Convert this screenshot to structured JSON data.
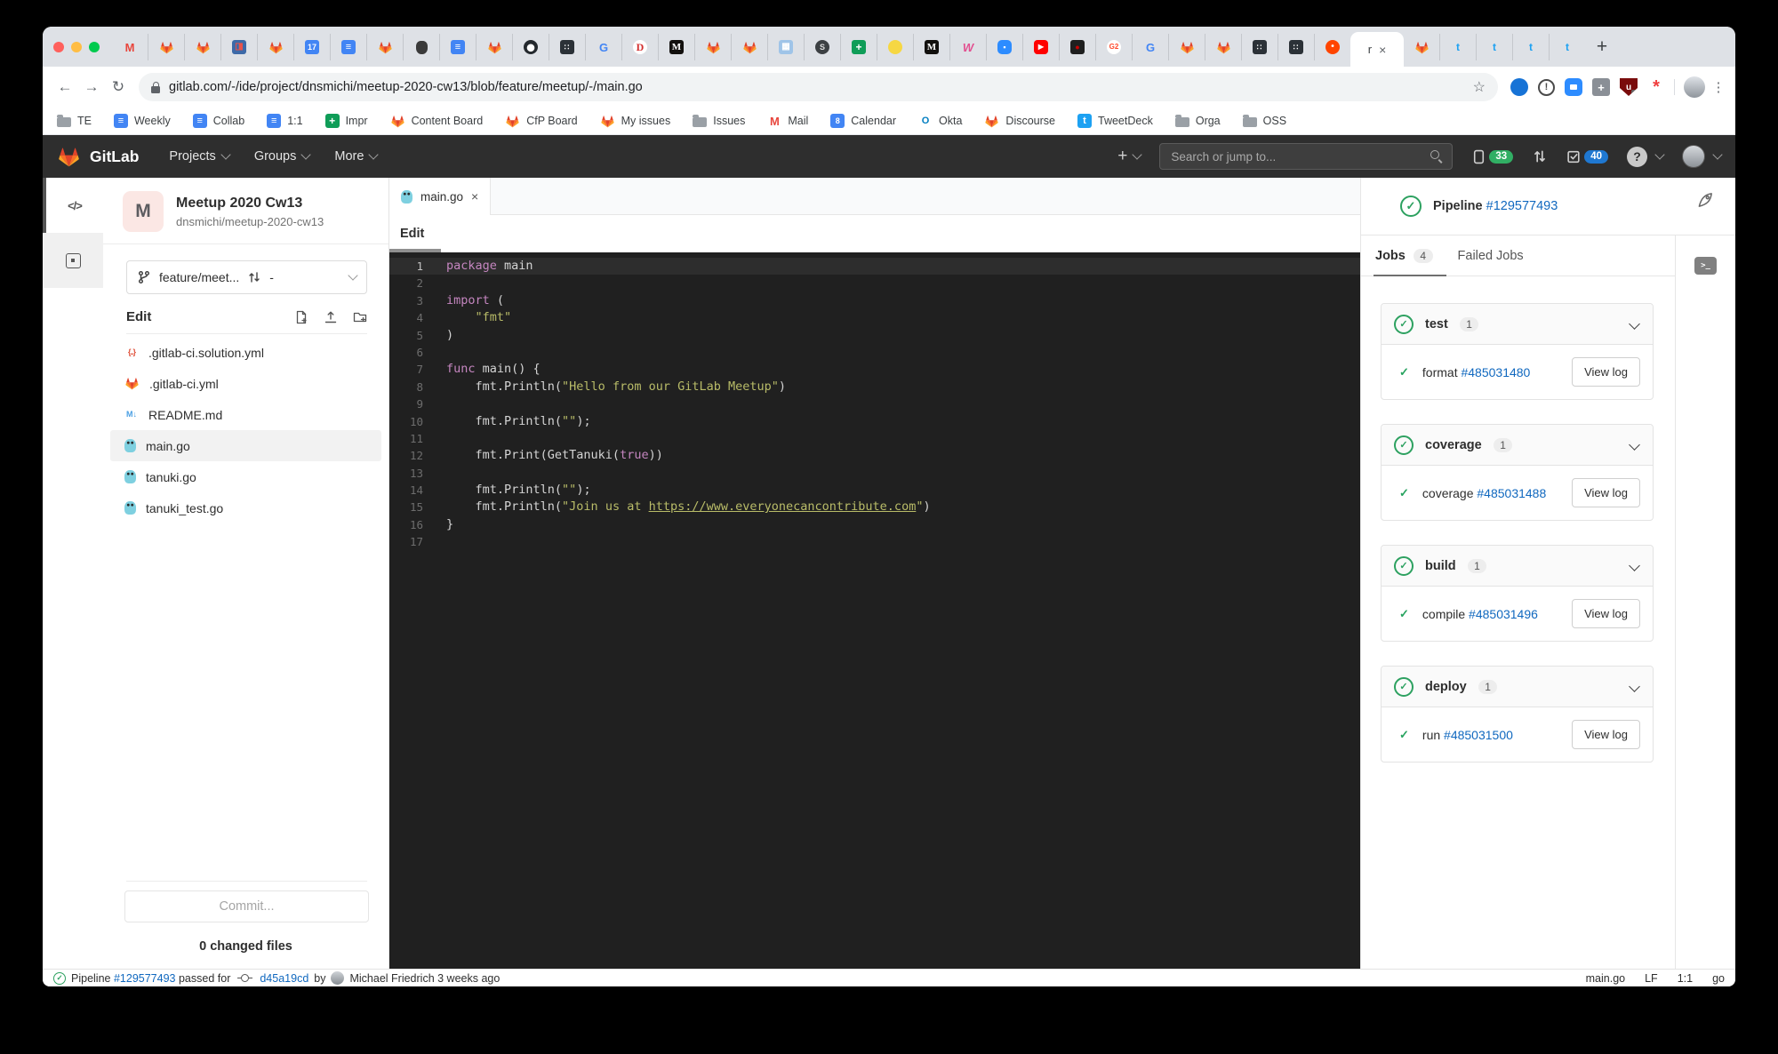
{
  "colors": {
    "accent_orange": "#fc6d26",
    "link_blue": "#1068bf",
    "success_green": "#2da160",
    "badge_green": "#31af64",
    "badge_blue": "#1f78d1",
    "editor_bg": "#202020",
    "keyword": "#c586c0",
    "string": "#b9bc68"
  },
  "icon_glyphs": {
    "gmail": "M",
    "gdoc": "≡",
    "gsheet": "+",
    "gcal17": "17",
    "gcal8": "8",
    "google": "G",
    "dred": "D",
    "medium": "M",
    "darkgrid": "∷",
    "globe": "S",
    "bee": "",
    "wistia": "W",
    "zoomcam": "▪",
    "youtube": "▶",
    "darkred": "●",
    "g2": "G2",
    "reddit": "•",
    "twitter": "t",
    "photo": "◨",
    "bluegrid": "▦",
    "apple": "",
    "github": "",
    "okta": "O",
    "tweetdeck": "t",
    "folder": "",
    "braces": "{..}",
    "markdown": "M↓",
    "gopher": "",
    "close": "×",
    "kebab": "⋮",
    "star": "☆",
    "back": "←",
    "forward": "→",
    "reload": "↻",
    "plus": "+",
    "help": "?",
    "code": "</>",
    "terminal": ">_"
  },
  "browser": {
    "url": "gitlab.com/-/ide/project/dnsmichi/meetup-2020-cw13/blob/feature/meetup/-/main.go",
    "active_tab_label": "r",
    "new_tab_label": "+",
    "tabs_before": [
      "gmail",
      "fox",
      "fox",
      "photo",
      "fox",
      "gcal17",
      "gdoc",
      "fox",
      "apple",
      "gdoc",
      "fox",
      "github",
      "darkgrid",
      "google",
      "dred",
      "medium",
      "fox",
      "fox",
      "bluegrid",
      "globe",
      "gsheet",
      "bee",
      "medium",
      "wistia",
      "zoomcam",
      "youtube",
      "darkred",
      "g2",
      "google",
      "fox",
      "fox",
      "darkgrid",
      "darkgrid",
      "reddit"
    ],
    "tabs_after": [
      "fox",
      "twitter",
      "twitter",
      "twitter",
      "twitter"
    ],
    "extensions": [
      {
        "id": "opera",
        "glyph": ""
      },
      {
        "id": "onepassword",
        "glyph": "!"
      },
      {
        "id": "zoomext",
        "glyph": ""
      },
      {
        "id": "pin",
        "glyph": "+"
      },
      {
        "id": "ublock",
        "glyph": "u",
        "badge": "1"
      },
      {
        "id": "sourcegraph",
        "glyph": "*"
      }
    ],
    "bookmarks": [
      {
        "icon": "folder",
        "label": "TE"
      },
      {
        "icon": "gdoc",
        "label": "Weekly"
      },
      {
        "icon": "gdoc",
        "label": "Collab"
      },
      {
        "icon": "gdoc",
        "label": "1:1"
      },
      {
        "icon": "gsheet",
        "label": "Impr"
      },
      {
        "icon": "fox",
        "label": "Content Board"
      },
      {
        "icon": "fox",
        "label": "CfP Board"
      },
      {
        "icon": "fox",
        "label": "My issues"
      },
      {
        "icon": "folder",
        "label": "Issues"
      },
      {
        "icon": "gmail",
        "label": "Mail"
      },
      {
        "icon": "gcal8",
        "label": "Calendar"
      },
      {
        "icon": "okta",
        "label": "Okta"
      },
      {
        "icon": "fox",
        "label": "Discourse"
      },
      {
        "icon": "tweetdeck",
        "label": "TweetDeck"
      },
      {
        "icon": "folder",
        "label": "Orga"
      },
      {
        "icon": "folder",
        "label": "OSS"
      }
    ]
  },
  "gitlab_header": {
    "logo_text": "GitLab",
    "menus": [
      {
        "label": "Projects"
      },
      {
        "label": "Groups"
      },
      {
        "label": "More"
      }
    ],
    "search_placeholder": "Search or jump to...",
    "issues_count": "33",
    "todos_count": "40"
  },
  "sidebar": {
    "project_initial": "M",
    "project_title": "Meetup 2020 Cw13",
    "project_path": "dnsmichi/meetup-2020-cw13",
    "branch": "feature/meet...",
    "merge_request": "-",
    "section_label": "Edit",
    "files": [
      {
        "icon": "braces",
        "name": ".gitlab-ci.solution.yml"
      },
      {
        "icon": "fox",
        "name": ".gitlab-ci.yml"
      },
      {
        "icon": "markdown",
        "name": "README.md"
      },
      {
        "icon": "gopher",
        "name": "main.go",
        "selected": true
      },
      {
        "icon": "gopher",
        "name": "tanuki.go"
      },
      {
        "icon": "gopher",
        "name": "tanuki_test.go"
      }
    ],
    "commit_button": "Commit...",
    "changed_files": "0 changed files"
  },
  "editor": {
    "tab": "main.go",
    "mode_tab": "Edit",
    "lines": [
      [
        {
          "c": "kw",
          "t": "package"
        },
        {
          "c": "tx",
          "t": " main"
        }
      ],
      [],
      [
        {
          "c": "kw",
          "t": "import"
        },
        {
          "c": "tx",
          "t": " ("
        }
      ],
      [
        {
          "c": "tx",
          "t": "    "
        },
        {
          "c": "str",
          "t": "\"fmt\""
        }
      ],
      [
        {
          "c": "tx",
          "t": ")"
        }
      ],
      [],
      [
        {
          "c": "kw",
          "t": "func"
        },
        {
          "c": "tx",
          "t": " main() {"
        }
      ],
      [
        {
          "c": "tx",
          "t": "    fmt.Println("
        },
        {
          "c": "str",
          "t": "\"Hello from our GitLab Meetup\""
        },
        {
          "c": "tx",
          "t": ")"
        }
      ],
      [],
      [
        {
          "c": "tx",
          "t": "    fmt.Println("
        },
        {
          "c": "str",
          "t": "\"\""
        },
        {
          "c": "tx",
          "t": ");"
        }
      ],
      [],
      [
        {
          "c": "tx",
          "t": "    fmt.Print(GetTanuki("
        },
        {
          "c": "kw",
          "t": "true"
        },
        {
          "c": "tx",
          "t": "))"
        }
      ],
      [],
      [
        {
          "c": "tx",
          "t": "    fmt.Println("
        },
        {
          "c": "str",
          "t": "\"\""
        },
        {
          "c": "tx",
          "t": ");"
        }
      ],
      [
        {
          "c": "tx",
          "t": "    fmt.Println("
        },
        {
          "c": "str",
          "t": "\"Join us at "
        },
        {
          "c": "link",
          "t": "https://www.everyonecancontribute.com"
        },
        {
          "c": "str",
          "t": "\""
        },
        {
          "c": "tx",
          "t": ")"
        }
      ],
      [
        {
          "c": "tx",
          "t": "}"
        }
      ],
      []
    ]
  },
  "jobs_panel": {
    "pipeline_label": "Pipeline",
    "pipeline_id": "#129577493",
    "tabs": [
      {
        "label": "Jobs",
        "count": "4"
      },
      {
        "label": "Failed Jobs"
      }
    ],
    "view_log": "View log",
    "stages": [
      {
        "name": "test",
        "count": "1",
        "job": "format",
        "job_id": "#485031480"
      },
      {
        "name": "coverage",
        "count": "1",
        "job": "coverage",
        "job_id": "#485031488"
      },
      {
        "name": "build",
        "count": "1",
        "job": "compile",
        "job_id": "#485031496"
      },
      {
        "name": "deploy",
        "count": "1",
        "job": "run",
        "job_id": "#485031500"
      }
    ]
  },
  "status_bar": {
    "pipeline_label": "Pipeline",
    "pipeline_id": "#129577493",
    "passed_text": "passed for",
    "commit_sha": "d45a19cd",
    "by_text": "by",
    "author_time": "Michael Friedrich 3 weeks ago",
    "file": "main.go",
    "eol": "LF",
    "cursor": "1:1",
    "lang": "go"
  }
}
